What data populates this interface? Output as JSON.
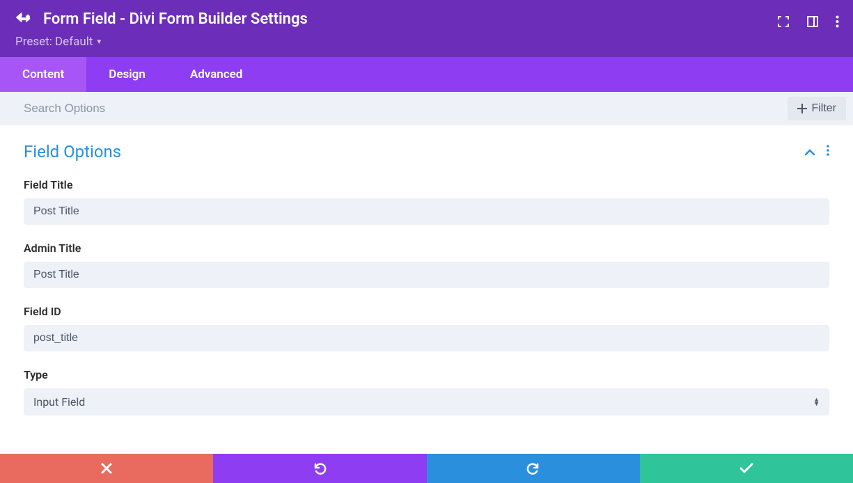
{
  "header": {
    "title": "Form Field - Divi Form Builder Settings",
    "preset_label": "Preset: Default"
  },
  "tabs": [
    {
      "label": "Content",
      "active": true
    },
    {
      "label": "Design",
      "active": false
    },
    {
      "label": "Advanced",
      "active": false
    }
  ],
  "search": {
    "placeholder": "Search Options",
    "filter_label": "Filter"
  },
  "section": {
    "title": "Field Options"
  },
  "fields": {
    "field_title": {
      "label": "Field Title",
      "value": "Post Title"
    },
    "admin_title": {
      "label": "Admin Title",
      "value": "Post Title"
    },
    "field_id": {
      "label": "Field ID",
      "value": "post_title"
    },
    "type": {
      "label": "Type",
      "value": "Input Field"
    }
  }
}
